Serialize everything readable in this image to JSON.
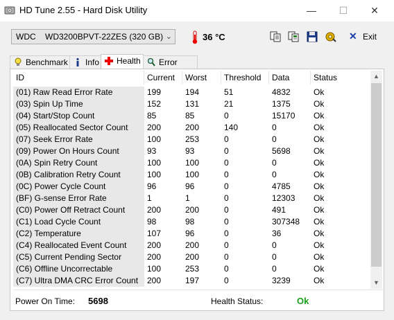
{
  "window": {
    "title": "HD Tune 2.55 - Hard Disk Utility",
    "minimize": "—",
    "maximize": "☐",
    "close": "✕"
  },
  "toolbar": {
    "drive_prefix": "WDC",
    "drive_name": "WD3200BPVT-22ZES (320 GB)",
    "temperature": "36 °C",
    "exit_label": "Exit"
  },
  "tabs": [
    {
      "label": "Benchmark"
    },
    {
      "label": "Info"
    },
    {
      "label": "Health"
    },
    {
      "label": "Error Scan"
    }
  ],
  "grid": {
    "columns": [
      "ID",
      "Current",
      "Worst",
      "Threshold",
      "Data",
      "Status"
    ],
    "rows": [
      [
        "(01) Raw Read Error Rate",
        "199",
        "194",
        "51",
        "4832",
        "Ok"
      ],
      [
        "(03) Spin Up Time",
        "152",
        "131",
        "21",
        "1375",
        "Ok"
      ],
      [
        "(04) Start/Stop Count",
        "85",
        "85",
        "0",
        "15170",
        "Ok"
      ],
      [
        "(05) Reallocated Sector Count",
        "200",
        "200",
        "140",
        "0",
        "Ok"
      ],
      [
        "(07) Seek Error Rate",
        "100",
        "253",
        "0",
        "0",
        "Ok"
      ],
      [
        "(09) Power On Hours Count",
        "93",
        "93",
        "0",
        "5698",
        "Ok"
      ],
      [
        "(0A) Spin Retry Count",
        "100",
        "100",
        "0",
        "0",
        "Ok"
      ],
      [
        "(0B) Calibration Retry Count",
        "100",
        "100",
        "0",
        "0",
        "Ok"
      ],
      [
        "(0C) Power Cycle Count",
        "96",
        "96",
        "0",
        "4785",
        "Ok"
      ],
      [
        "(BF) G-sense Error Rate",
        "1",
        "1",
        "0",
        "12303",
        "Ok"
      ],
      [
        "(C0) Power Off Retract Count",
        "200",
        "200",
        "0",
        "491",
        "Ok"
      ],
      [
        "(C1) Load Cycle Count",
        "98",
        "98",
        "0",
        "307348",
        "Ok"
      ],
      [
        "(C2) Temperature",
        "107",
        "96",
        "0",
        "36",
        "Ok"
      ],
      [
        "(C4) Reallocated Event Count",
        "200",
        "200",
        "0",
        "0",
        "Ok"
      ],
      [
        "(C5) Current Pending Sector",
        "200",
        "200",
        "0",
        "0",
        "Ok"
      ],
      [
        "(C6) Offline Uncorrectable",
        "100",
        "253",
        "0",
        "0",
        "Ok"
      ],
      [
        "(C7) Ultra DMA CRC Error Count",
        "200",
        "197",
        "0",
        "3239",
        "Ok"
      ]
    ]
  },
  "footer": {
    "power_on_label": "Power On Time:",
    "power_on_value": "5698",
    "health_label": "Health Status:",
    "health_value": "Ok"
  },
  "colors": {
    "health_ok": "#1aa01a",
    "id_column_bg": "#e8e8e8"
  }
}
